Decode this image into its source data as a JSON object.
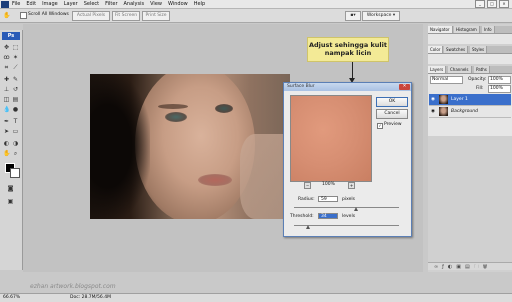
{
  "menu": {
    "items": [
      "File",
      "Edit",
      "Image",
      "Layer",
      "Select",
      "Filter",
      "Analysis",
      "View",
      "Window",
      "Help"
    ],
    "workspace_label": "Workspace ▾"
  },
  "options": {
    "scroll_all_label": "Scroll All Windows",
    "actual_pixels": "Actual Pixels",
    "fit_screen": "Fit Screen",
    "print_size": "Print Size"
  },
  "tools": {
    "logo": "Ps"
  },
  "callout": {
    "line1": "Adjust sehingga kulit",
    "line2": "nampak licin"
  },
  "dialog": {
    "title": "Surface Blur",
    "ok": "OK",
    "cancel": "Cancel",
    "preview_label": "Preview",
    "zoom": "100%",
    "radius_label": "Radius:",
    "radius_value": "59",
    "radius_unit": "pixels",
    "threshold_label": "Threshold:",
    "threshold_value": "34",
    "threshold_unit": "levels"
  },
  "panels": {
    "top_tabs": [
      "Navigator",
      "Histogram",
      "Info"
    ],
    "mid_tabs": [
      "Color",
      "Swatches",
      "Styles"
    ],
    "layer_tabs": [
      "Layers",
      "Channels",
      "Paths"
    ],
    "blend_mode": "Normal",
    "opacity_label": "Opacity:",
    "opacity_value": "100%",
    "fill_label": "Fill:",
    "fill_value": "100%",
    "layers": [
      {
        "name": "Layer 1",
        "selected": true
      },
      {
        "name": "Background",
        "selected": false
      }
    ]
  },
  "status": {
    "zoom": "66.67%",
    "doc": "Doc: 28.7M/56.4M"
  },
  "watermark": "ezhan artwork.blogspot.com"
}
